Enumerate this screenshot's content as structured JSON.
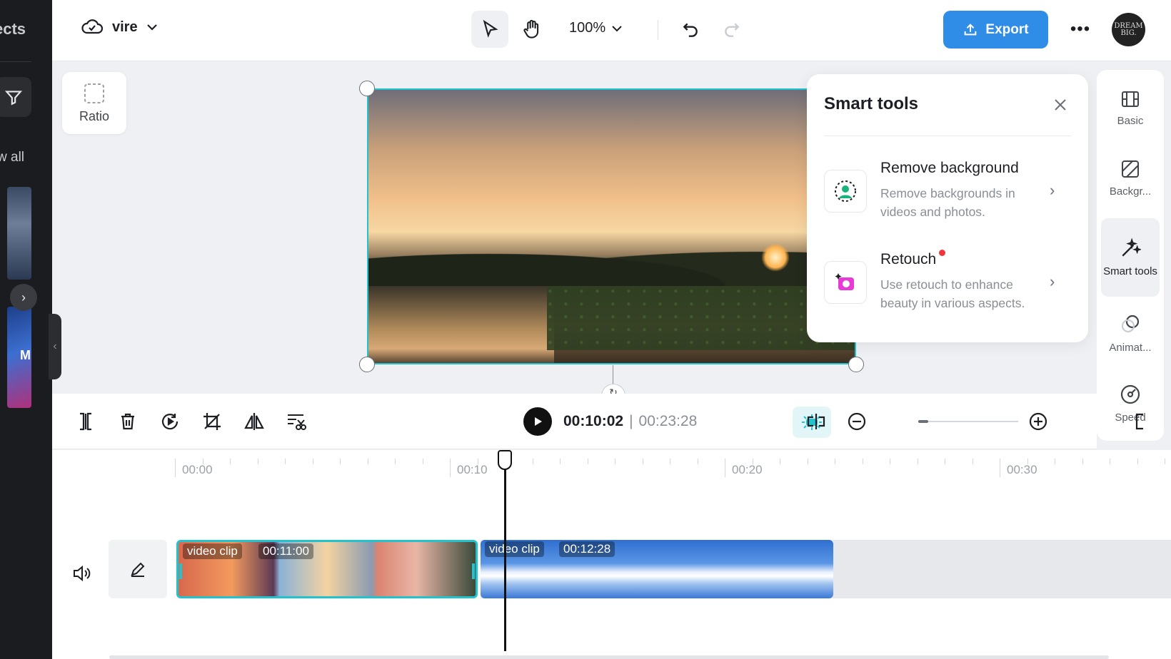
{
  "left_panel": {
    "title": "ects",
    "view_all": "w all",
    "thumb_letter": "M"
  },
  "topbar": {
    "project_name": "vire",
    "zoom": "100%",
    "export_label": "Export",
    "avatar_text": "DREAM BIG."
  },
  "canvas": {
    "ratio_label": "Ratio"
  },
  "smart_tools": {
    "title": "Smart tools",
    "items": [
      {
        "title": "Remove background",
        "desc": "Remove backgrounds in videos and photos."
      },
      {
        "title": "Retouch",
        "desc": "Use retouch to enhance beauty in various aspects."
      }
    ]
  },
  "right_sidebar": {
    "items": [
      {
        "label": "Basic",
        "icon": "film-icon"
      },
      {
        "label": "Backgr...",
        "icon": "background-icon"
      },
      {
        "label": "Smart tools",
        "icon": "magic-wand-icon"
      },
      {
        "label": "Animat...",
        "icon": "animation-icon"
      },
      {
        "label": "Speed",
        "icon": "speed-icon"
      }
    ]
  },
  "timeline": {
    "current_time": "00:10:02",
    "separator": "|",
    "total_time": "00:23:28",
    "ruler": [
      "00:00",
      "00:10",
      "00:20",
      "00:30"
    ],
    "clips": [
      {
        "label": "video clip",
        "duration": "00:11:00"
      },
      {
        "label": "video clip",
        "duration": "00:12:28"
      }
    ]
  },
  "colors": {
    "accent": "#22c3cf",
    "export": "#2f8de8",
    "notification": "#f0353d"
  }
}
